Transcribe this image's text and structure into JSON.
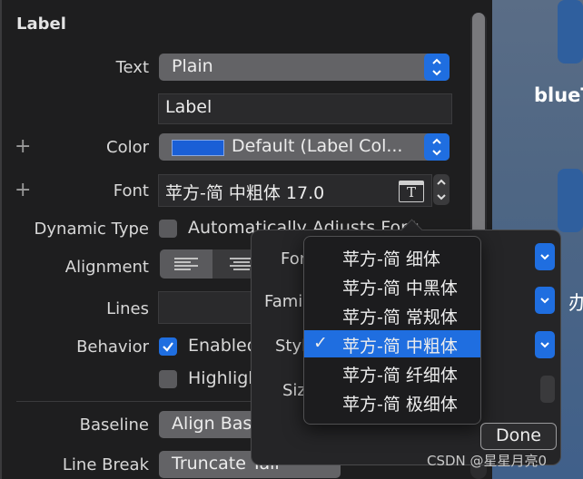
{
  "inspector": {
    "section_title": "Label",
    "text_row": {
      "label": "Text",
      "value": "Plain"
    },
    "text_content": "Label",
    "color_row": {
      "label": "Color",
      "value": "Default (Label Col..."
    },
    "font_row": {
      "label": "Font",
      "value": "苹方-简 中粗体 17.0"
    },
    "dynamic_type_row": {
      "label": "Dynamic Type",
      "checkbox_label": "Automatically Adjusts Font"
    },
    "alignment_row": {
      "label": "Alignment"
    },
    "lines_row": {
      "label": "Lines"
    },
    "behavior_row": {
      "label": "Behavior",
      "option1": "Enabled",
      "option2": "Highlighted"
    },
    "baseline_row": {
      "label": "Baseline",
      "value": "Align Baselines"
    },
    "linebreak_row": {
      "label": "Line Break",
      "value": "Truncate Tail"
    }
  },
  "font_popover": {
    "font_label": "Font",
    "family_label": "Family",
    "style_label": "Style",
    "size_label": "Size",
    "done_label": "Done"
  },
  "style_menu": {
    "items": [
      "苹方-简 细体",
      "苹方-简 中黑体",
      "苹方-简 常规体",
      "苹方-简 中粗体",
      "苹方-简 纤细体",
      "苹方-简 极细体"
    ],
    "selected_index": 3,
    "checkmark": "✓"
  },
  "canvas": {
    "partial_label": "blueT",
    "partial_cjk": "办"
  },
  "watermark": "CSDN @星星月亮0",
  "colors": {
    "accent": "#1f6ee0",
    "panel": "#1e1e1f",
    "popup": "#636366"
  }
}
